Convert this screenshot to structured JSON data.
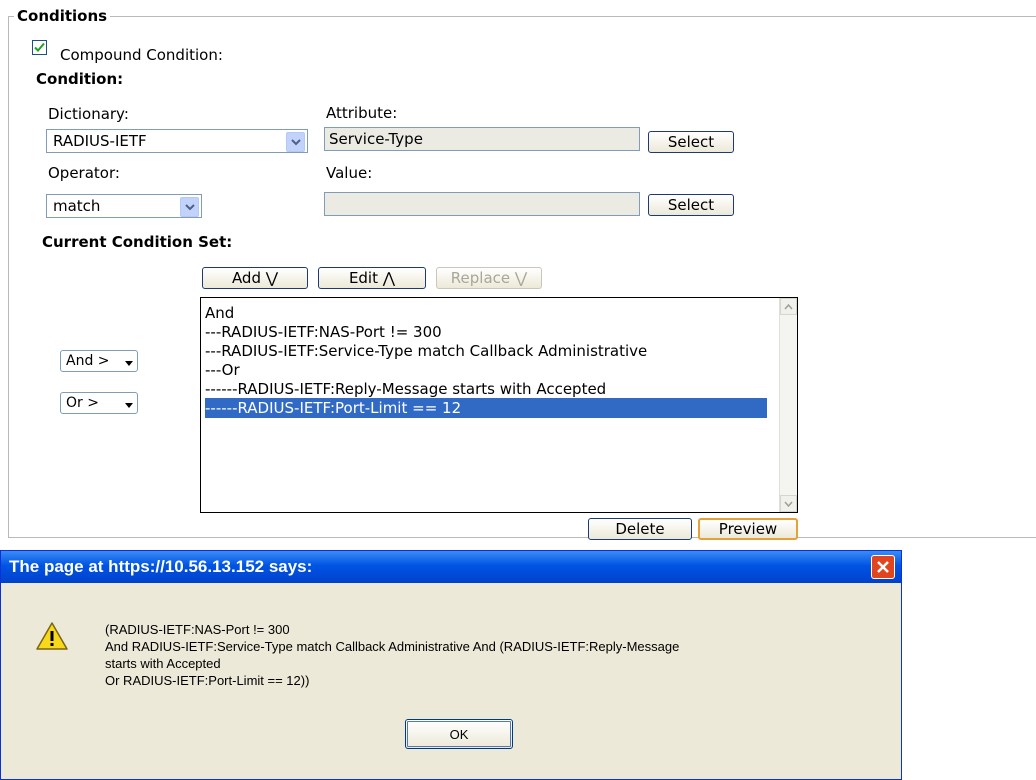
{
  "conditions": {
    "legend": "Conditions",
    "compound_label": "Compound Condition:",
    "compound_checked": true,
    "condition_heading": "Condition:",
    "dictionary_label": "Dictionary:",
    "dictionary_value": "RADIUS-IETF",
    "attribute_label": "Attribute:",
    "attribute_value": "Service-Type",
    "select_label": "Select",
    "operator_label": "Operator:",
    "operator_value": "match",
    "value_label": "Value:",
    "value_value": "",
    "current_set_heading": "Current Condition Set:",
    "add_label": "Add ⋁",
    "edit_label": "Edit ⋀",
    "replace_label": "Replace ⋁",
    "and_select": "And >",
    "or_select": "Or >",
    "list": [
      "And",
      "---RADIUS-IETF:NAS-Port != 300",
      "---RADIUS-IETF:Service-Type match Callback Administrative",
      "---Or",
      "------RADIUS-IETF:Reply-Message starts with Accepted",
      "------RADIUS-IETF:Port-Limit == 12"
    ],
    "selected_index": 5,
    "delete_label": "Delete",
    "preview_label": "Preview"
  },
  "dialog": {
    "title": "The page at https://10.56.13.152 says:",
    "message": "(RADIUS-IETF:NAS-Port != 300\nAnd RADIUS-IETF:Service-Type match Callback Administrative And (RADIUS-IETF:Reply-Message\nstarts with Accepted\nOr RADIUS-IETF:Port-Limit == 12))",
    "ok_label": "OK",
    "icon": "warning-icon"
  },
  "colors": {
    "titlebar": "#0054e3",
    "selection": "#316ac5",
    "dialog_bg": "#ece9d8",
    "close": "#e0451f"
  }
}
